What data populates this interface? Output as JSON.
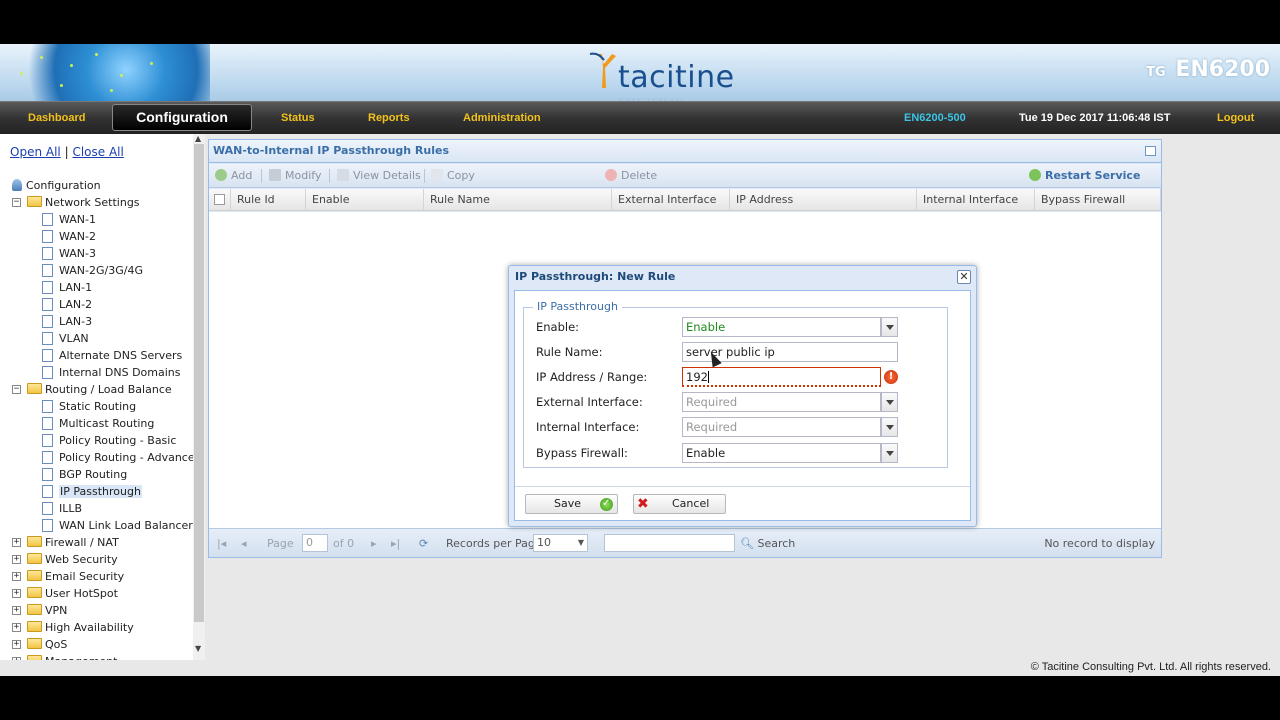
{
  "header": {
    "brand": "tacitine",
    "model_prefix": "TG",
    "model": "EN6200"
  },
  "nav": {
    "dashboard": "Dashboard",
    "configuration": "Configuration",
    "status": "Status",
    "reports": "Reports",
    "administration": "Administration",
    "device": "EN6200-500",
    "datetime": "Tue 19 Dec 2017 11:06:48 IST",
    "logout": "Logout"
  },
  "sidebar": {
    "open_all": "Open All",
    "separator": "|",
    "close_all": "Close All",
    "root": "Configuration",
    "groups": [
      {
        "label": "Network Settings",
        "expanded": true,
        "items": [
          "WAN-1",
          "WAN-2",
          "WAN-3",
          "WAN-2G/3G/4G",
          "LAN-1",
          "LAN-2",
          "LAN-3",
          "VLAN",
          "Alternate DNS Servers",
          "Internal DNS Domains"
        ]
      },
      {
        "label": "Routing / Load Balance",
        "expanded": true,
        "items": [
          "Static Routing",
          "Multicast Routing",
          "Policy Routing - Basic",
          "Policy Routing - Advanced",
          "BGP Routing",
          "IP Passthrough",
          "ILLB",
          "WAN Link Load Balancer"
        ]
      },
      {
        "label": "Firewall / NAT"
      },
      {
        "label": "Web Security"
      },
      {
        "label": "Email Security"
      },
      {
        "label": "User HotSpot"
      },
      {
        "label": "VPN"
      },
      {
        "label": "High Availability"
      },
      {
        "label": "QoS"
      },
      {
        "label": "Management"
      }
    ],
    "selected": "IP Passthrough"
  },
  "panel": {
    "title": "WAN-to-Internal IP Passthrough Rules",
    "toolbar": {
      "add": "Add",
      "modify": "Modify",
      "view_details": "View Details",
      "copy": "Copy",
      "delete": "Delete",
      "restart": "Restart Service"
    },
    "columns": [
      "Rule Id",
      "Enable",
      "Rule Name",
      "External Interface",
      "IP Address",
      "Internal Interface",
      "Bypass Firewall"
    ],
    "pager": {
      "page_label": "Page",
      "page_value": "0",
      "of_label": "of 0",
      "records_label": "Records per Page",
      "records_value": "10",
      "search_label": "Search",
      "empty": "No record to display"
    }
  },
  "dialog": {
    "title": "IP Passthrough: New Rule",
    "legend": "IP Passthrough",
    "fields": {
      "enable_label": "Enable:",
      "enable_value": "Enable",
      "rule_name_label": "Rule Name:",
      "rule_name_value": "server public ip",
      "ip_label": "IP Address / Range:",
      "ip_value": "192",
      "ext_label": "External Interface:",
      "ext_placeholder": "Required",
      "int_label": "Internal Interface:",
      "int_placeholder": "Required",
      "bypass_label": "Bypass Firewall:",
      "bypass_value": "Enable"
    },
    "save": "Save",
    "cancel": "Cancel"
  },
  "footer": {
    "copyright": "© Tacitine Consulting Pvt. Ltd. All rights reserved."
  },
  "colors": {
    "accent": "#f3c21a",
    "link": "#1a3fb0",
    "panel_title": "#3a6ea8",
    "error": "#c30",
    "device": "#3cc3e6"
  }
}
